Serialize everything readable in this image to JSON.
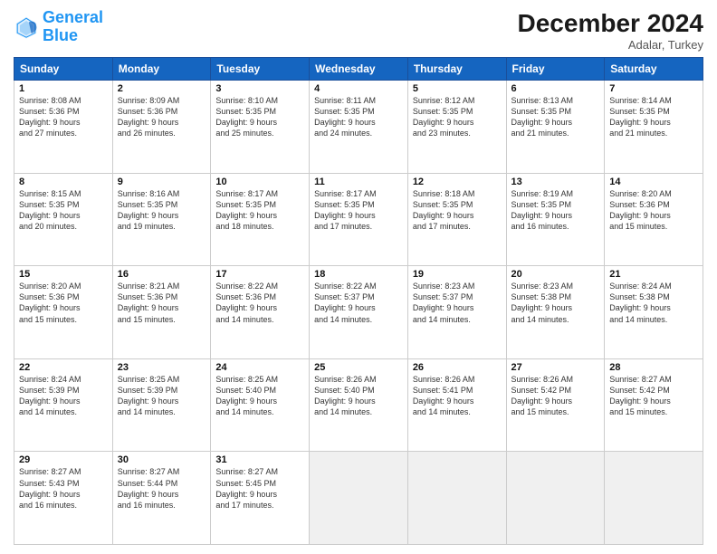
{
  "header": {
    "logo_general": "General",
    "logo_blue": "Blue",
    "month_title": "December 2024",
    "location": "Adalar, Turkey"
  },
  "days_of_week": [
    "Sunday",
    "Monday",
    "Tuesday",
    "Wednesday",
    "Thursday",
    "Friday",
    "Saturday"
  ],
  "weeks": [
    [
      {
        "day": "1",
        "lines": [
          "Sunrise: 8:08 AM",
          "Sunset: 5:36 PM",
          "Daylight: 9 hours",
          "and 27 minutes."
        ]
      },
      {
        "day": "2",
        "lines": [
          "Sunrise: 8:09 AM",
          "Sunset: 5:36 PM",
          "Daylight: 9 hours",
          "and 26 minutes."
        ]
      },
      {
        "day": "3",
        "lines": [
          "Sunrise: 8:10 AM",
          "Sunset: 5:35 PM",
          "Daylight: 9 hours",
          "and 25 minutes."
        ]
      },
      {
        "day": "4",
        "lines": [
          "Sunrise: 8:11 AM",
          "Sunset: 5:35 PM",
          "Daylight: 9 hours",
          "and 24 minutes."
        ]
      },
      {
        "day": "5",
        "lines": [
          "Sunrise: 8:12 AM",
          "Sunset: 5:35 PM",
          "Daylight: 9 hours",
          "and 23 minutes."
        ]
      },
      {
        "day": "6",
        "lines": [
          "Sunrise: 8:13 AM",
          "Sunset: 5:35 PM",
          "Daylight: 9 hours",
          "and 21 minutes."
        ]
      },
      {
        "day": "7",
        "lines": [
          "Sunrise: 8:14 AM",
          "Sunset: 5:35 PM",
          "Daylight: 9 hours",
          "and 21 minutes."
        ]
      }
    ],
    [
      {
        "day": "8",
        "lines": [
          "Sunrise: 8:15 AM",
          "Sunset: 5:35 PM",
          "Daylight: 9 hours",
          "and 20 minutes."
        ]
      },
      {
        "day": "9",
        "lines": [
          "Sunrise: 8:16 AM",
          "Sunset: 5:35 PM",
          "Daylight: 9 hours",
          "and 19 minutes."
        ]
      },
      {
        "day": "10",
        "lines": [
          "Sunrise: 8:17 AM",
          "Sunset: 5:35 PM",
          "Daylight: 9 hours",
          "and 18 minutes."
        ]
      },
      {
        "day": "11",
        "lines": [
          "Sunrise: 8:17 AM",
          "Sunset: 5:35 PM",
          "Daylight: 9 hours",
          "and 17 minutes."
        ]
      },
      {
        "day": "12",
        "lines": [
          "Sunrise: 8:18 AM",
          "Sunset: 5:35 PM",
          "Daylight: 9 hours",
          "and 17 minutes."
        ]
      },
      {
        "day": "13",
        "lines": [
          "Sunrise: 8:19 AM",
          "Sunset: 5:35 PM",
          "Daylight: 9 hours",
          "and 16 minutes."
        ]
      },
      {
        "day": "14",
        "lines": [
          "Sunrise: 8:20 AM",
          "Sunset: 5:36 PM",
          "Daylight: 9 hours",
          "and 15 minutes."
        ]
      }
    ],
    [
      {
        "day": "15",
        "lines": [
          "Sunrise: 8:20 AM",
          "Sunset: 5:36 PM",
          "Daylight: 9 hours",
          "and 15 minutes."
        ]
      },
      {
        "day": "16",
        "lines": [
          "Sunrise: 8:21 AM",
          "Sunset: 5:36 PM",
          "Daylight: 9 hours",
          "and 15 minutes."
        ]
      },
      {
        "day": "17",
        "lines": [
          "Sunrise: 8:22 AM",
          "Sunset: 5:36 PM",
          "Daylight: 9 hours",
          "and 14 minutes."
        ]
      },
      {
        "day": "18",
        "lines": [
          "Sunrise: 8:22 AM",
          "Sunset: 5:37 PM",
          "Daylight: 9 hours",
          "and 14 minutes."
        ]
      },
      {
        "day": "19",
        "lines": [
          "Sunrise: 8:23 AM",
          "Sunset: 5:37 PM",
          "Daylight: 9 hours",
          "and 14 minutes."
        ]
      },
      {
        "day": "20",
        "lines": [
          "Sunrise: 8:23 AM",
          "Sunset: 5:38 PM",
          "Daylight: 9 hours",
          "and 14 minutes."
        ]
      },
      {
        "day": "21",
        "lines": [
          "Sunrise: 8:24 AM",
          "Sunset: 5:38 PM",
          "Daylight: 9 hours",
          "and 14 minutes."
        ]
      }
    ],
    [
      {
        "day": "22",
        "lines": [
          "Sunrise: 8:24 AM",
          "Sunset: 5:39 PM",
          "Daylight: 9 hours",
          "and 14 minutes."
        ]
      },
      {
        "day": "23",
        "lines": [
          "Sunrise: 8:25 AM",
          "Sunset: 5:39 PM",
          "Daylight: 9 hours",
          "and 14 minutes."
        ]
      },
      {
        "day": "24",
        "lines": [
          "Sunrise: 8:25 AM",
          "Sunset: 5:40 PM",
          "Daylight: 9 hours",
          "and 14 minutes."
        ]
      },
      {
        "day": "25",
        "lines": [
          "Sunrise: 8:26 AM",
          "Sunset: 5:40 PM",
          "Daylight: 9 hours",
          "and 14 minutes."
        ]
      },
      {
        "day": "26",
        "lines": [
          "Sunrise: 8:26 AM",
          "Sunset: 5:41 PM",
          "Daylight: 9 hours",
          "and 14 minutes."
        ]
      },
      {
        "day": "27",
        "lines": [
          "Sunrise: 8:26 AM",
          "Sunset: 5:42 PM",
          "Daylight: 9 hours",
          "and 15 minutes."
        ]
      },
      {
        "day": "28",
        "lines": [
          "Sunrise: 8:27 AM",
          "Sunset: 5:42 PM",
          "Daylight: 9 hours",
          "and 15 minutes."
        ]
      }
    ],
    [
      {
        "day": "29",
        "lines": [
          "Sunrise: 8:27 AM",
          "Sunset: 5:43 PM",
          "Daylight: 9 hours",
          "and 16 minutes."
        ]
      },
      {
        "day": "30",
        "lines": [
          "Sunrise: 8:27 AM",
          "Sunset: 5:44 PM",
          "Daylight: 9 hours",
          "and 16 minutes."
        ]
      },
      {
        "day": "31",
        "lines": [
          "Sunrise: 8:27 AM",
          "Sunset: 5:45 PM",
          "Daylight: 9 hours",
          "and 17 minutes."
        ]
      },
      null,
      null,
      null,
      null
    ]
  ]
}
